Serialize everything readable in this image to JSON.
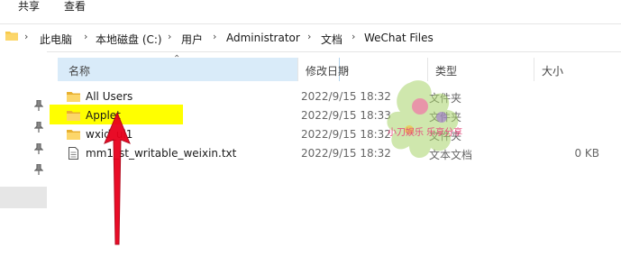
{
  "ribbon": {
    "tabs": [
      "共享",
      "查看"
    ]
  },
  "address": {
    "crumbs": [
      "此电脑",
      "本地磁盘 (C:)",
      "用户",
      "Administrator",
      "文档",
      "WeChat Files"
    ]
  },
  "columns": {
    "name": "名称",
    "date": "修改日期",
    "type": "类型",
    "size": "大小"
  },
  "rows": [
    {
      "name": "All Users",
      "date": "2022/9/15 18:32",
      "type": "文件夹",
      "size": "",
      "kind": "folder"
    },
    {
      "name": "Applet",
      "date": "2022/9/15 18:33",
      "type": "文件夹",
      "size": "",
      "kind": "folder",
      "highlighted": true
    },
    {
      "name": "wxid_ul1",
      "date": "2022/9/15 18:32",
      "type": "文件夹",
      "size": "",
      "kind": "folder"
    },
    {
      "name": "mm1_st_writable_weixin.txt",
      "date": "2022/9/15 18:32",
      "type": "文本文档",
      "size": "0 KB",
      "kind": "text"
    }
  ],
  "watermark": {
    "text": "小刀娱乐 乐享分享"
  },
  "colors": {
    "header_bg": "#d9ebf9",
    "highlight": "#ffff00",
    "arrow": "#e8001c",
    "folder": "#f7c948"
  },
  "icons": {
    "folder": "folder-icon",
    "text": "text-file-icon",
    "pin": "pin-icon",
    "sort": "sort-up-icon",
    "dropdown": "chevron-down-icon"
  }
}
